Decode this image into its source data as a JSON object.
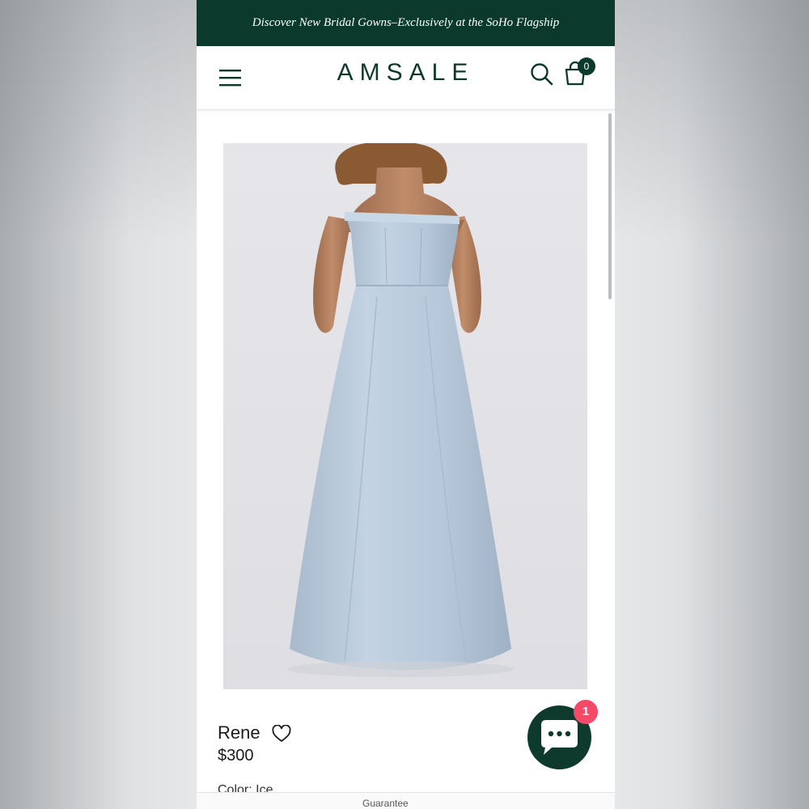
{
  "announcement": "Discover New Bridal Gowns–Exclusively at the SoHo Flagship",
  "header": {
    "brand": "AMSALE",
    "menu_icon": "hamburger-menu-icon",
    "search_icon": "search-icon",
    "bag_icon": "shopping-bag-icon",
    "bag_count": "0"
  },
  "product": {
    "image_icon": "product-photo-strapless-gown",
    "name": "Rene",
    "price": "$300",
    "wishlist_icon": "heart-icon",
    "color_line": "Color: Ice"
  },
  "footer_text": "Guarantee",
  "chat": {
    "icon": "chat-bubble-icon",
    "badge": "1"
  },
  "colors": {
    "brand_green": "#0b3a2c",
    "dress_blue": "#b9cadb",
    "badge_red": "#f24a67"
  }
}
